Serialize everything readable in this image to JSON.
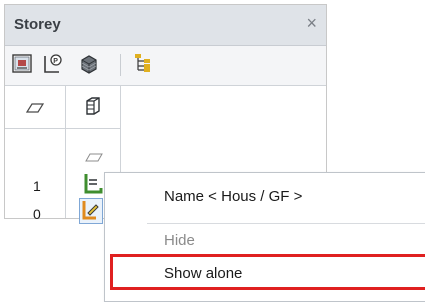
{
  "panel": {
    "title": "Storey",
    "close_glyph": "×",
    "toolbar": {
      "icons": [
        "storey-properties-icon",
        "storey-plan-icon",
        "storey-3d-icon",
        "storey-tree-icon"
      ]
    },
    "columns": [
      "plane-icon",
      "cube-icon"
    ],
    "rows": [
      {
        "number": "1",
        "status_icon": "storey-layout-icon"
      },
      {
        "number": "0",
        "status_icon": "storey-edit-icon"
      }
    ]
  },
  "context_menu": {
    "items": [
      {
        "label": "Name < Hous / GF >",
        "enabled": true
      },
      {
        "label": "Hide",
        "enabled": false
      },
      {
        "label": "Show alone",
        "enabled": true,
        "highlighted": true
      }
    ]
  },
  "colors": {
    "header_bg": "#dfe3e8",
    "highlight_border": "#e02020",
    "icon_green": "#4a9a3a",
    "icon_orange": "#e08a1e"
  }
}
